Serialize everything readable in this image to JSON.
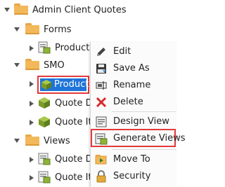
{
  "tree": {
    "root": "Admin Client Quotes",
    "forms_folder": "Forms",
    "forms_item": "Products",
    "smo_folder": "SMO",
    "product": "Product",
    "quote_det_1": "Quote Det",
    "quote_ite_1": "Quote Item",
    "views_folder": "Views",
    "quote_det_2": "Quote Det",
    "quote_ite_2": "Quote Iter"
  },
  "menu": {
    "edit": "Edit",
    "save_as": "Save As",
    "rename": "Rename",
    "delete": "Delete",
    "design_view": "Design View",
    "generate_views": "Generate Views",
    "move_to": "Move To",
    "security": "Security"
  },
  "colors": {
    "selection": "#1e74d8",
    "highlight_border": "#e23a3a",
    "folder": "#f2b85a"
  }
}
